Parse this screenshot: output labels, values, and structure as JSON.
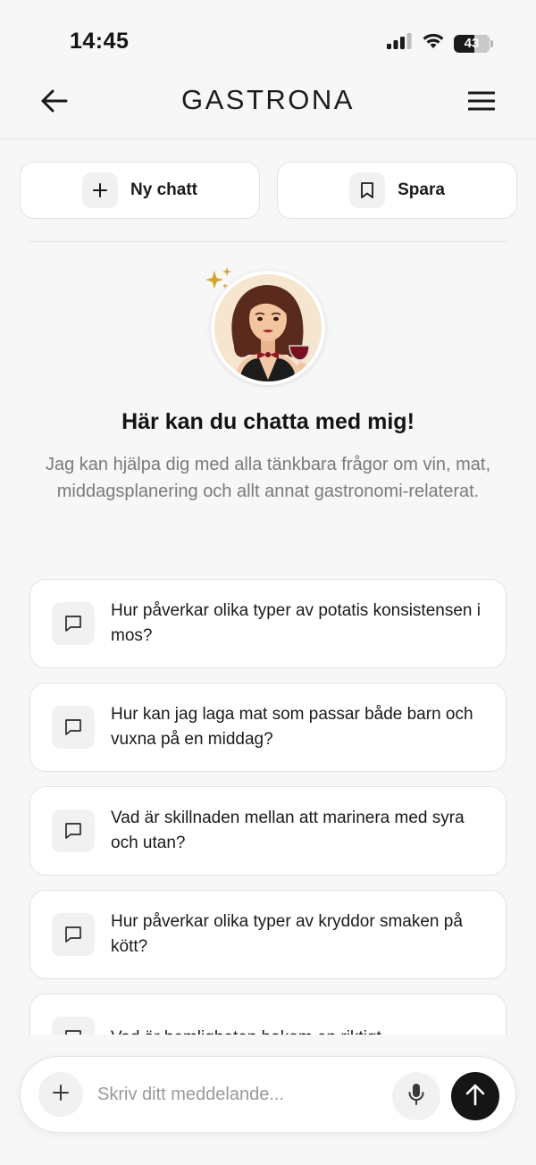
{
  "status_bar": {
    "time": "14:45",
    "battery_level": "43",
    "icons": [
      "signal-icon",
      "wifi-icon",
      "battery-icon"
    ]
  },
  "header": {
    "brand": "GASTRONA",
    "back_icon": "arrow-left-icon",
    "menu_icon": "hamburger-menu-icon"
  },
  "actions": {
    "new_chat_label": "Ny chatt",
    "new_chat_icon": "plus-icon",
    "save_label": "Spara",
    "save_icon": "bookmark-icon"
  },
  "intro": {
    "avatar": "sommelier-avatar",
    "title": "Här kan du chatta med mig!",
    "description": "Jag kan hjälpa dig med alla tänkbara frågor om vin, mat, middagsplanering och allt annat gastronomi-relaterat."
  },
  "suggestions": [
    {
      "text": "Hur påverkar olika typer av potatis konsistensen i mos?",
      "icon": "chat-bubble-icon"
    },
    {
      "text": "Hur kan jag laga mat som passar både barn och vuxna på en middag?",
      "icon": "chat-bubble-icon"
    },
    {
      "text": "Vad är skillnaden mellan att marinera med syra och utan?",
      "icon": "chat-bubble-icon"
    },
    {
      "text": "Hur påverkar olika typer av kryddor smaken på kött?",
      "icon": "chat-bubble-icon"
    },
    {
      "text": "Vad är hemligheten bakom en riktigt",
      "icon": "chat-bubble-icon"
    }
  ],
  "composer": {
    "placeholder": "Skriv ditt meddelande...",
    "value": "",
    "attach_icon": "plus-icon",
    "mic_icon": "microphone-icon",
    "send_icon": "arrow-up-icon"
  },
  "colors": {
    "background": "#f7f7f7",
    "card": "#ffffff",
    "accent_dark": "#151515",
    "muted_text": "#7a7a7a",
    "sparkle": "#d4a62a"
  }
}
